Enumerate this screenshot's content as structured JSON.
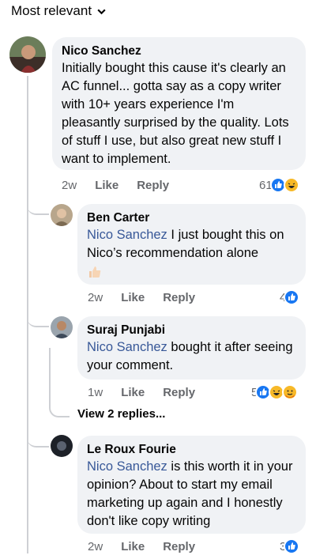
{
  "sort": {
    "label": "Most relevant"
  },
  "comments": [
    {
      "author": "Nico Sanchez",
      "mention": "",
      "text": "Initially bought this cause it's clearly an AC funnel... gotta say as a copy writer with 10+ years experience I'm pleasantly surprised by the quality. Lots of stuff I use, but also great new stuff I want to implement.",
      "time": "2w",
      "like": "Like",
      "reply": "Reply",
      "reactions": "61"
    }
  ],
  "replies": [
    {
      "author": "Ben Carter",
      "mention": "Nico Sanchez",
      "text": " I just bought this on Nico’s recommendation alone",
      "time": "2w",
      "like": "Like",
      "reply": "Reply",
      "reactions": "4"
    },
    {
      "author": "Suraj Punjabi",
      "mention": "Nico Sanchez",
      "text": " bought it after seeing your comment.",
      "time": "1w",
      "like": "Like",
      "reply": "Reply",
      "reactions": "5"
    },
    {
      "author": "Le Roux Fourie",
      "mention": "Nico Sanchez",
      "text": " is this worth it in your opinion? About to start my email marketing up again and I honestly don't like copy writing",
      "time": "2w",
      "like": "Like",
      "reply": "Reply",
      "reactions": "3"
    }
  ],
  "view_replies": "View 2 replies...",
  "colors": {
    "like_blue": "#1877f2",
    "mention": "#385898",
    "bubble": "#f0f2f5",
    "meta": "#65676b"
  },
  "icons": [
    "chevron-down-icon",
    "like-reaction-icon",
    "haha-reaction-icon",
    "thumbs-up-emoji-icon"
  ]
}
